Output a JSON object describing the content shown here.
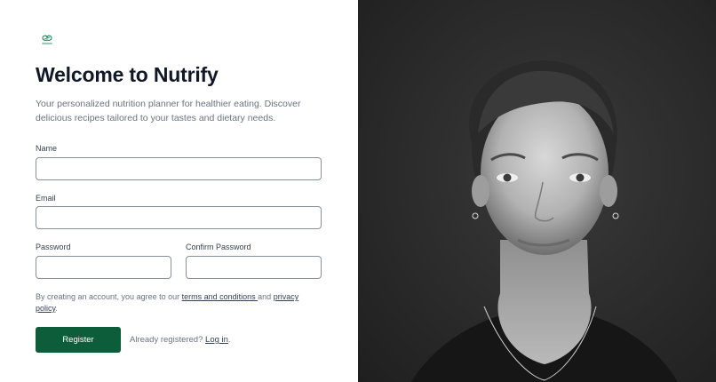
{
  "brand": {
    "logo_icon": "nutrify-logo-icon",
    "accent_color": "#0d5c3a"
  },
  "header": {
    "title": "Welcome to Nutrify",
    "subtitle": "Your personalized nutrition planner for healthier eating. Discover delicious recipes tailored to your tastes and dietary needs."
  },
  "form": {
    "name_label": "Name",
    "name_value": "",
    "email_label": "Email",
    "email_value": "",
    "password_label": "Password",
    "password_value": "",
    "confirm_password_label": "Confirm Password",
    "confirm_password_value": ""
  },
  "terms": {
    "prefix": "By creating an account, you agree to our ",
    "terms_link": "terms and conditions ",
    "middle": "and ",
    "privacy_link": "privacy policy",
    "suffix": "."
  },
  "actions": {
    "register_label": "Register",
    "already_registered": "Already registered? ",
    "login_link": "Log in",
    "login_suffix": "."
  },
  "hero": {
    "image_description_icon": "portrait-photo"
  }
}
